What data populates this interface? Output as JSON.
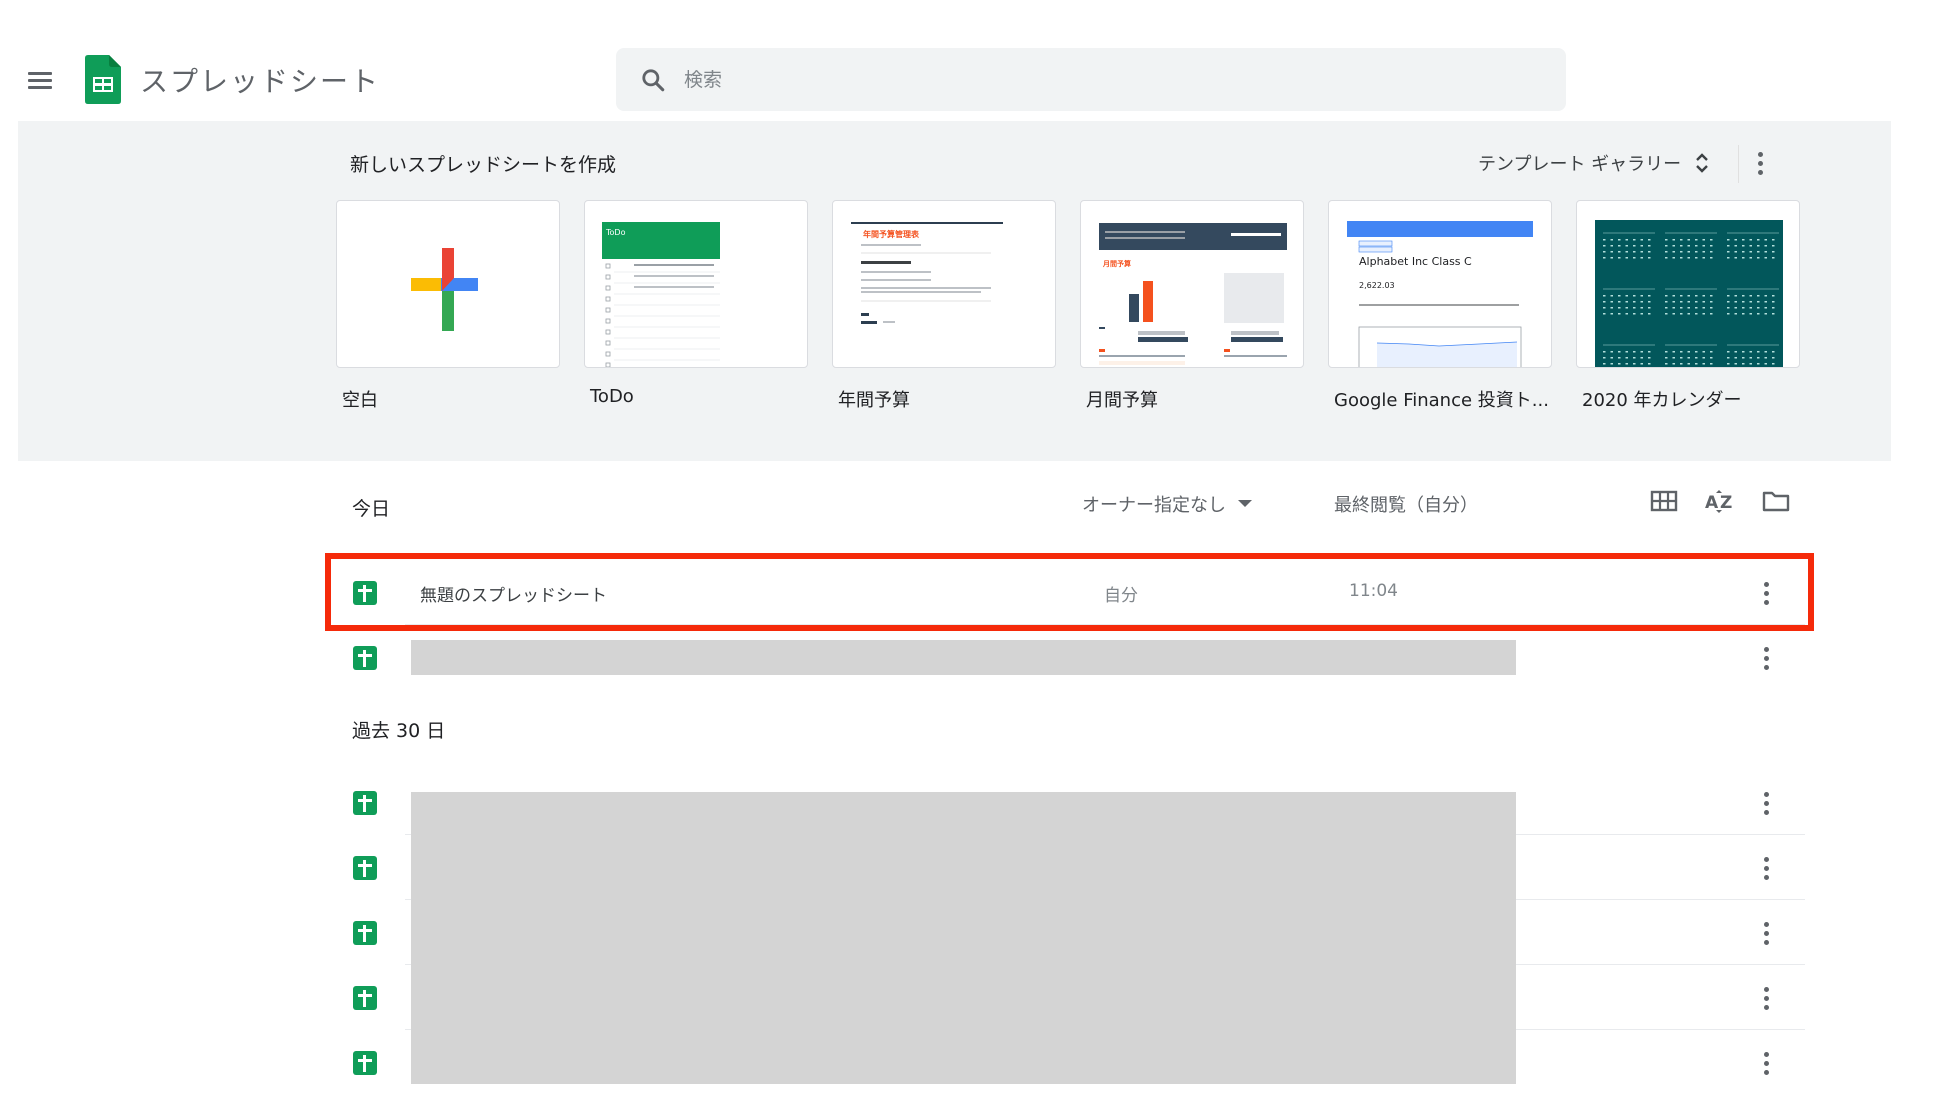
{
  "header": {
    "app_title": "スプレッドシート",
    "search_placeholder": "検索",
    "menu_icon": "hamburger-menu-icon",
    "logo_icon": "google-sheets-logo-icon",
    "search_icon": "search-icon"
  },
  "templates": {
    "title": "新しいスプレッドシートを作成",
    "gallery_label": "テンプレート ギャラリー",
    "gallery_icon": "unfold-more-icon",
    "more_icon": "more-vert-icon",
    "items": [
      {
        "label": "空白"
      },
      {
        "label": "ToDo",
        "preview_title": "ToDo"
      },
      {
        "label": "年間予算",
        "preview_title": "年間予算管理表"
      },
      {
        "label": "月間予算",
        "preview_title": "月間予算"
      },
      {
        "label": "Google Finance 投資ト...",
        "preview_title": "Alphabet Inc Class C",
        "preview_value": "2,622.03"
      },
      {
        "label": "2020 年カレンダー"
      }
    ]
  },
  "list": {
    "sections": [
      {
        "title": "今日"
      },
      {
        "title": "過去 30 日"
      }
    ],
    "columns": {
      "owner": "オーナー指定なし",
      "last_viewed": "最終閲覧（自分）"
    },
    "view_icons": [
      "grid-view-icon",
      "sort-az-icon",
      "folder-icon"
    ],
    "rows": [
      {
        "name": "無題のスプレッドシート",
        "owner": "自分",
        "time": "11:04",
        "highlighted": true
      },
      {
        "name": "",
        "owner": "",
        "time": "",
        "redacted": true
      }
    ],
    "older_rows_count": 5
  },
  "colors": {
    "sheets_green": "#0f9d58",
    "highlight_red": "#f52a0a",
    "template_bg": "#f1f3f4"
  }
}
